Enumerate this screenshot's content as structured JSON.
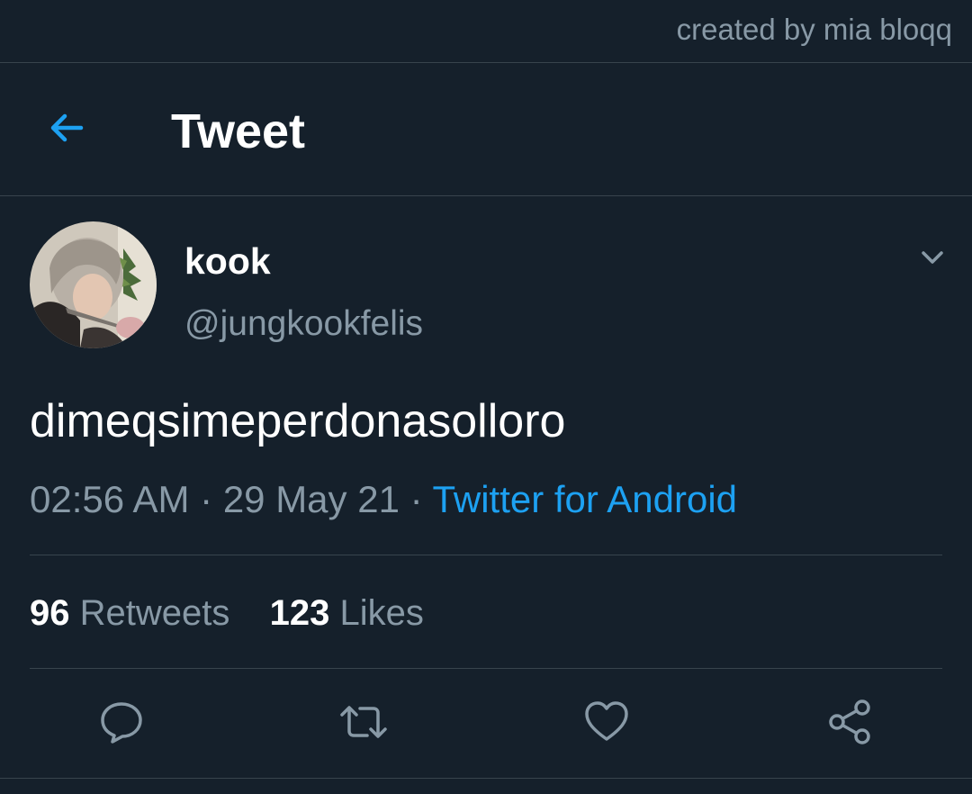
{
  "watermark": "created by mia bloqq",
  "header": {
    "title": "Tweet",
    "back_icon": "arrow-left-icon"
  },
  "tweet": {
    "display_name": "kook",
    "handle": "@jungkookfelis",
    "text": "dimeqsimeperdonasolloro",
    "time": "02:56 AM",
    "separator": "·",
    "date": "29 May 21",
    "source": "Twitter for Android",
    "retweets_count": "96",
    "retweets_label": "Retweets",
    "likes_count": "123",
    "likes_label": "Likes"
  },
  "actions": [
    {
      "icon": "reply-icon"
    },
    {
      "icon": "retweet-icon"
    },
    {
      "icon": "heart-icon"
    },
    {
      "icon": "share-icon"
    }
  ],
  "colors": {
    "background": "#15202b",
    "accent": "#1da1f2",
    "secondary_text": "#8899a6",
    "divider": "#38444d"
  }
}
